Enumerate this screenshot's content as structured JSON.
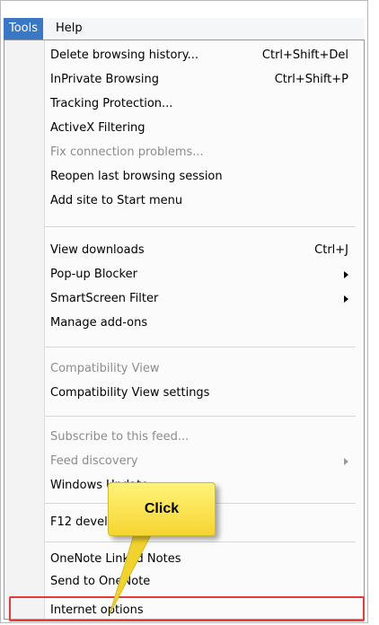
{
  "menubar": {
    "tools_label": "Tools",
    "help_label": "Help"
  },
  "menu": {
    "items": [
      {
        "label": "Delete browsing history...",
        "shortcut": "Ctrl+Shift+Del",
        "disabled": false,
        "submenu": false
      },
      {
        "label": "InPrivate Browsing",
        "shortcut": "Ctrl+Shift+P",
        "disabled": false,
        "submenu": false
      },
      {
        "label": "Tracking Protection...",
        "shortcut": "",
        "disabled": false,
        "submenu": false
      },
      {
        "label": "ActiveX Filtering",
        "shortcut": "",
        "disabled": false,
        "submenu": false
      },
      {
        "label": "Fix connection problems...",
        "shortcut": "",
        "disabled": true,
        "submenu": false
      },
      {
        "label": "Reopen last browsing session",
        "shortcut": "",
        "disabled": false,
        "submenu": false
      },
      {
        "label": "Add site to Start menu",
        "shortcut": "",
        "disabled": false,
        "submenu": false
      },
      {
        "label": "View downloads",
        "shortcut": "Ctrl+J",
        "disabled": false,
        "submenu": false
      },
      {
        "label": "Pop-up Blocker",
        "shortcut": "",
        "disabled": false,
        "submenu": true
      },
      {
        "label": "SmartScreen Filter",
        "shortcut": "",
        "disabled": false,
        "submenu": true
      },
      {
        "label": "Manage add-ons",
        "shortcut": "",
        "disabled": false,
        "submenu": false
      },
      {
        "label": "Compatibility View",
        "shortcut": "",
        "disabled": true,
        "submenu": false
      },
      {
        "label": "Compatibility View settings",
        "shortcut": "",
        "disabled": false,
        "submenu": false
      },
      {
        "label": "Subscribe to this feed...",
        "shortcut": "",
        "disabled": true,
        "submenu": false
      },
      {
        "label": "Feed discovery",
        "shortcut": "",
        "disabled": true,
        "submenu": true
      },
      {
        "label": "Windows Update",
        "shortcut": "",
        "disabled": false,
        "submenu": false
      },
      {
        "label": "F12 developer tools",
        "shortcut": "",
        "disabled": false,
        "submenu": false
      },
      {
        "label": "OneNote Linked Notes",
        "shortcut": "",
        "disabled": false,
        "submenu": false
      },
      {
        "label": "Send to OneNote",
        "shortcut": "",
        "disabled": false,
        "submenu": false
      },
      {
        "label": "Internet options",
        "shortcut": "",
        "disabled": false,
        "submenu": false
      }
    ]
  },
  "callout": {
    "label": "Click"
  },
  "colors": {
    "tools_active_bg": "#3a78c6",
    "highlight_border": "#e23b3b",
    "callout_fill": "#f6d531",
    "disabled_text": "#8c8c8c"
  }
}
